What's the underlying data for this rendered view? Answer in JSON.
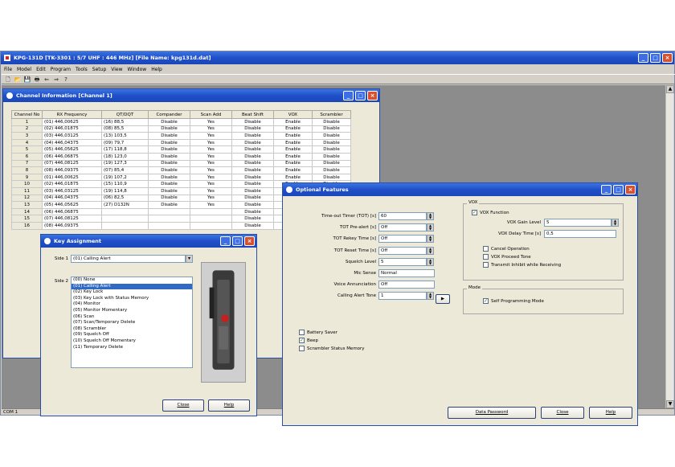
{
  "app": {
    "title": "KPG-131D [TK-3301 : 5/7 UHF : 446 MHz] [File Name: kpg131d.dat]",
    "menu": [
      "File",
      "Model",
      "Edit",
      "Program",
      "Tools",
      "Setup",
      "View",
      "Window",
      "Help"
    ],
    "toolbar_icons": [
      "new-icon",
      "open-icon",
      "save-icon",
      "print-icon",
      "read-radio-icon",
      "write-radio-icon",
      "help-icon"
    ],
    "status": "COM 1",
    "colors": {
      "titlebar": "#1f4fc8",
      "workspace": "#8c8c8c",
      "selection": "#316ac5"
    }
  },
  "channel_window": {
    "title": "Channel Information [Channel   1]",
    "columns": [
      "Channel No",
      "RX Frequency",
      "QT/DQT",
      "Compander",
      "Scan Add",
      "Beat Shift",
      "VOX",
      "Scrambler"
    ],
    "rows": [
      [
        "1",
        "(01)  446,00625",
        "(16)  88,5",
        "Disable",
        "Yes",
        "Disable",
        "Enable",
        "Disable"
      ],
      [
        "2",
        "(02)  446,01875",
        "(08)  85,5",
        "Disable",
        "Yes",
        "Disable",
        "Enable",
        "Disable"
      ],
      [
        "3",
        "(03)  446,03125",
        "(13)  103,5",
        "Disable",
        "Yes",
        "Disable",
        "Enable",
        "Disable"
      ],
      [
        "4",
        "(04)  446,04375",
        "(09)  79,7",
        "Disable",
        "Yes",
        "Disable",
        "Enable",
        "Disable"
      ],
      [
        "5",
        "(05)  446,05625",
        "(17)  118,8",
        "Disable",
        "Yes",
        "Disable",
        "Enable",
        "Disable"
      ],
      [
        "6",
        "(06)  446,06875",
        "(18)  123,0",
        "Disable",
        "Yes",
        "Disable",
        "Enable",
        "Disable"
      ],
      [
        "7",
        "(07)  446,08125",
        "(19)  127,3",
        "Disable",
        "Yes",
        "Disable",
        "Enable",
        "Disable"
      ],
      [
        "8",
        "(08)  446,09375",
        "(07)  85,4",
        "Disable",
        "Yes",
        "Disable",
        "Enable",
        "Disable"
      ],
      [
        "9",
        "(01)  446,00625",
        "(19)  107,2",
        "Disable",
        "Yes",
        "Disable",
        "Enable",
        "Disable"
      ],
      [
        "10",
        "(02)  446,01875",
        "(15)  110,9",
        "Disable",
        "Yes",
        "Disable",
        "Enable",
        "Disable"
      ],
      [
        "11",
        "(03)  446,03125",
        "(19)  114,8",
        "Disable",
        "Yes",
        "Disable",
        "Enable",
        "Disable"
      ],
      [
        "12",
        "(04)  446,04375",
        "(06)  82,5",
        "Disable",
        "Yes",
        "Disable",
        "Enable",
        "Disable"
      ],
      [
        "13",
        "(05)  446,05625",
        "(27)  D132N",
        "Disable",
        "Yes",
        "Disable",
        "Enable",
        "Disable"
      ],
      [
        "14",
        "(06)  446,06875",
        "",
        "",
        "",
        "Disable",
        "",
        ""
      ],
      [
        "15",
        "(07)  446,08125",
        "",
        "",
        "",
        "Disable",
        "",
        ""
      ],
      [
        "16",
        "(08)  446,09375",
        "",
        "",
        "",
        "Disable",
        "",
        ""
      ]
    ]
  },
  "optional_features": {
    "title": "Optional Features",
    "fields": [
      {
        "label": "Time-out Timer (TOT) [s]",
        "value": "60"
      },
      {
        "label": "TOT Pre-alert [s]",
        "value": "Off"
      },
      {
        "label": "TOT Rekey Time [s]",
        "value": "Off"
      },
      {
        "label": "TOT Reset Time [s]",
        "value": "Off"
      },
      {
        "label": "Squelch Level",
        "value": "5"
      },
      {
        "label": "Mic Sense",
        "value": "Normal"
      },
      {
        "label": "Voice Annunciation",
        "value": "Off"
      },
      {
        "label": "Calling Alert Tone",
        "value": "1"
      }
    ],
    "play_label": "▶",
    "vox": {
      "title": "VOX",
      "function_label": "VOX Function",
      "gain_label": "VOX Gain Level",
      "gain_value": "5",
      "delay_label": "VOX Delay Time [s]",
      "delay_value": "0,5",
      "cancel_label": "Cancel Operation",
      "proceed_label": "VOX Proceed Tone",
      "transmit_label": "Transmit Inhibit while Receiving"
    },
    "mode": {
      "title": "Mode",
      "self_prog_label": "Self Programming Mode"
    },
    "checks": {
      "battery_saver": "Battery Saver",
      "beep": "Beep",
      "scrambler_status": "Scrambler Status Memory"
    },
    "buttons": {
      "data_password": "Data Password",
      "close": "Close",
      "help": "Help"
    }
  },
  "key_assignment": {
    "title": "Key Assignment",
    "side1_label": "Side 1",
    "side1_value": "(01) Calling Alert",
    "side2_label": "Side 2",
    "options": [
      "(00) None",
      "(01) Calling Alert",
      "(02) Key Lock",
      "(03) Key Lock with Status Memory",
      "(04) Monitor",
      "(05) Monitor Momentary",
      "(06) Scan",
      "(07) Scan/Temporary Delete",
      "(08) Scrambler",
      "(09) Squelch Off",
      "(10) Squelch Off Momentary",
      "(11) Temporary Delete"
    ],
    "selected_index": 1,
    "buttons": {
      "close": "Close",
      "help": "Help"
    }
  }
}
